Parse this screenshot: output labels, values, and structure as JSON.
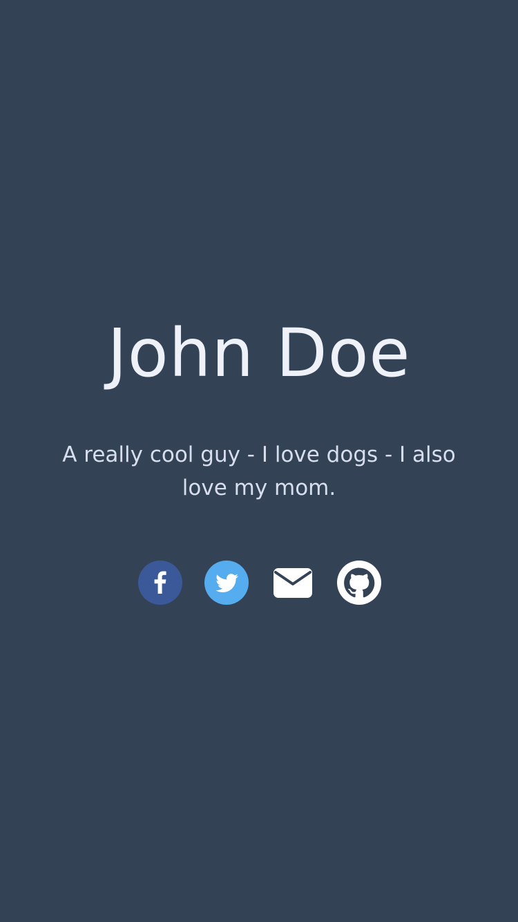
{
  "profile": {
    "name": "John Doe",
    "tagline": "A really cool guy - I love dogs - I also love my mom."
  },
  "social_links": [
    {
      "name": "facebook",
      "icon": "facebook-icon",
      "color": "#3b5998"
    },
    {
      "name": "twitter",
      "icon": "twitter-icon",
      "color": "#55acee"
    },
    {
      "name": "email",
      "icon": "envelope-icon",
      "color": "#ffffff"
    },
    {
      "name": "github",
      "icon": "github-icon",
      "color": "#ffffff"
    }
  ],
  "colors": {
    "background": "#344256",
    "name_text": "#eef1f8",
    "tagline_text": "#d7deee"
  }
}
